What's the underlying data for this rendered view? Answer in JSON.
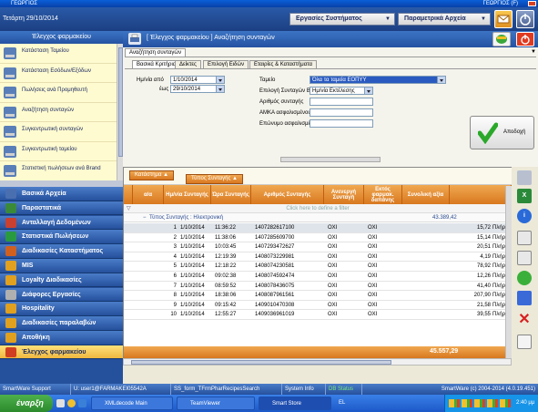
{
  "window": {
    "title_left": "ΓΕΩΡΓΙΟΣ",
    "title_right": "ΓΕΩΡΓΙΟΣ (F)"
  },
  "topbar": {
    "date": "Τετάρτη 29/10/2014",
    "menu_system": "Εργασίες Συστήματος",
    "menu_params": "Παραμετρικά Αρχεία"
  },
  "sidebar": {
    "title": "Έλεγχος φαρμακείου",
    "items": [
      {
        "label": "Κατάσταση Ταμείου"
      },
      {
        "label": "Κατάσταση Εσόδων/Εξόδων"
      },
      {
        "label": "Πωλήσεις ανά Προμηθευτή"
      },
      {
        "label": "Αναζήτηση συνταγών"
      },
      {
        "label": "Συγκεντρωτική συνταγών"
      },
      {
        "label": "Συγκεντρωτική ταμείου"
      },
      {
        "label": "Στατιστική πωλήσεων ανά Brand"
      }
    ],
    "modules": [
      {
        "label": "Βασικά Αρχεία",
        "color": "#4a6fb0"
      },
      {
        "label": "Παραστατικά",
        "color": "#3a8a3a"
      },
      {
        "label": "Ανταλλαγή Δεδομένων",
        "color": "#c84030"
      },
      {
        "label": "Στατιστικά Πωλήσεων",
        "color": "#2a9a40"
      },
      {
        "label": "Διαδικασίες Καταστήματος",
        "color": "#d06020"
      },
      {
        "label": "MIS",
        "color": "#e0a020"
      },
      {
        "label": "Loyalty Διαδικασίες",
        "color": "#e0a020"
      },
      {
        "label": "Διάφορες Εργασίες",
        "color": "#b0b0b0"
      },
      {
        "label": "Hospitality",
        "color": "#e0a020"
      },
      {
        "label": "Διαδικασίες παραλαβών",
        "color": "#e0a020"
      },
      {
        "label": "Αποθήκη",
        "color": "#e0a020"
      },
      {
        "label": "Έλεγχος φαρμακείου",
        "color": "#d04020"
      }
    ]
  },
  "main": {
    "title": "[ Έλεγχος φαρμακείου ] Αναζήτηση συνταγών",
    "outer_tab": "Αναζήτηση συνταγών",
    "tabs": [
      {
        "label": "Βασικά Κριτήρια"
      },
      {
        "label": "Δείκτες"
      },
      {
        "label": "Επιλογή Ειδών"
      },
      {
        "label": "Εταιρίες & Καταστήματα"
      }
    ],
    "filters": {
      "date_from_label": "Ημ/νία από",
      "date_from": "1/10/2014",
      "date_to_label": "έως",
      "date_to": "29/10/2014",
      "fund_label": "Ταμείο",
      "fund_value": "Όλα τα ταμεία ΕΟΠΥΥ",
      "type_label": "Επιλογή Συνταγών Βάσει",
      "type_value": "Ημ/νία Εκτέλεσης",
      "rx_number_label": "Αριθμός συνταγής",
      "amka_label": "ΑΜΚΑ ασφαλισμένου",
      "surname_label": "Επώνυμο ασφαλισμένου"
    },
    "accept_button": "Αποδοχή"
  },
  "grid": {
    "group_tags": [
      "Κατάστημα",
      "Τύπος Συνταγής"
    ],
    "columns": [
      "α/α",
      "Ημ/νία Συνταγής",
      "Ώρα Συνταγής",
      "Αριθμός Συνταγής",
      "Ανενεργή Συνταγή",
      "Εκτός φαρμακ. δαπάνης",
      "Συνολική αξία",
      ""
    ],
    "filter_hint": "Click here to define a filter",
    "group_row": {
      "label": "Τύπος Συνταγής : Ηλεκτρονική",
      "total": "43.389,42"
    },
    "rows": [
      {
        "n": "1",
        "date": "1/10/2014",
        "time": "11:36:22",
        "rx": "1407282617100",
        "inactive": "ΟΧΙ",
        "excl": "ΟΧΙ",
        "value": "15,72",
        "extra": "Πλήρης Ε"
      },
      {
        "n": "2",
        "date": "1/10/2014",
        "time": "11:38:06",
        "rx": "1407285609700",
        "inactive": "ΟΧΙ",
        "excl": "ΟΧΙ",
        "value": "15,14",
        "extra": "Πλήρης Ε"
      },
      {
        "n": "3",
        "date": "1/10/2014",
        "time": "10:03:45",
        "rx": "1407293472627",
        "inactive": "ΟΧΙ",
        "excl": "ΟΧΙ",
        "value": "20,51",
        "extra": "Πλήρης Ε"
      },
      {
        "n": "4",
        "date": "1/10/2014",
        "time": "12:19:39",
        "rx": "1408073229981",
        "inactive": "ΟΧΙ",
        "excl": "ΟΧΙ",
        "value": "4,19",
        "extra": "Πλήρης Ε"
      },
      {
        "n": "5",
        "date": "1/10/2014",
        "time": "12:18:22",
        "rx": "1408074230581",
        "inactive": "ΟΧΙ",
        "excl": "ΟΧΙ",
        "value": "78,92",
        "extra": "Πλήρης Ε"
      },
      {
        "n": "6",
        "date": "1/10/2014",
        "time": "09:02:38",
        "rx": "1408074592474",
        "inactive": "ΟΧΙ",
        "excl": "ΟΧΙ",
        "value": "12,26",
        "extra": "Πλήρης Ε"
      },
      {
        "n": "7",
        "date": "1/10/2014",
        "time": "08:59:52",
        "rx": "1408078436075",
        "inactive": "ΟΧΙ",
        "excl": "ΟΧΙ",
        "value": "41,40",
        "extra": "Πλήρης Ε"
      },
      {
        "n": "8",
        "date": "1/10/2014",
        "time": "18:38:06",
        "rx": "1408087961561",
        "inactive": "ΟΧΙ",
        "excl": "ΟΧΙ",
        "value": "207,90",
        "extra": "Πλήρης Ε"
      },
      {
        "n": "9",
        "date": "1/10/2014",
        "time": "09:15:42",
        "rx": "1409010470308",
        "inactive": "ΟΧΙ",
        "excl": "ΟΧΙ",
        "value": "21,58",
        "extra": "Πλήρης Ε"
      },
      {
        "n": "10",
        "date": "1/10/2014",
        "time": "12:55:27",
        "rx": "1409036961019",
        "inactive": "ΟΧΙ",
        "excl": "ΟΧΙ",
        "value": "39,55",
        "extra": "Πλήρης Ε"
      }
    ],
    "footer_total": "45.557,29"
  },
  "statusbar": {
    "support": "SmartWare Support",
    "user": "U: user1@FARMAKEI05542A",
    "form": "SS_form_TFrmPharRecipesSearch",
    "sysinfo": "System Info",
    "db": "DB Status",
    "copyright": "SmartWare (c) 2004-2014 (4.0.19.451)"
  },
  "taskbar": {
    "start": "έναρξη",
    "tasks": [
      "XMLdecode Main",
      "TeamViewer",
      "Smart Store"
    ],
    "lang": "EL",
    "clock": "2:40 μμ"
  }
}
